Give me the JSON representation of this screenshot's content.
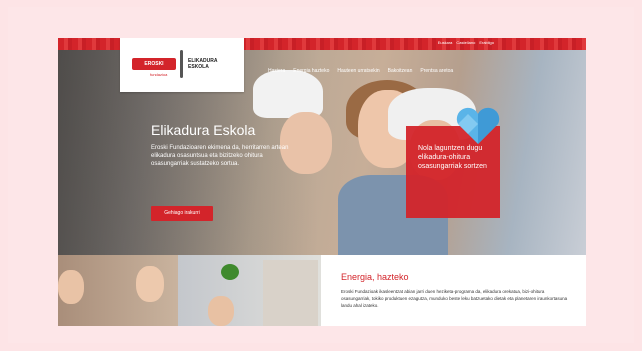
{
  "top_links": [
    "Euskara",
    "Castellano",
    "Erabilgo"
  ],
  "logo": {
    "brand": "EROSKI",
    "brand_sub": "fundazioa",
    "name_line1": "ELIKADURA",
    "name_line2": "ESKOLA"
  },
  "nav": [
    "Hasiera",
    "Energia hazteko",
    "Hauteen urratsekin",
    "Bakoitzean",
    "Prentsa aretoa"
  ],
  "hero": {
    "title": "Elikadura Eskola",
    "text": "Eroski Fundazioaren ekimena da, herritarren artean elikadura osasuntsua eta bizitzeko ohitura osasungarriak sustatzeko sortua.",
    "button": "Gehiago irakurri"
  },
  "callout": {
    "text": "Nola laguntzen dugu elikadura-ohitura osasungarriak sortzen"
  },
  "section": {
    "title": "Energia, hazteko",
    "text": "Eroski Fundazioak ikasleentzat abian jarri duen heziketa-programa da, elikadura orekatua, bizi-ohitura osasungarriak, tokiko produktuen ezagutza, munduko beste leku batzuetako dietak eta planetaren iraunkortasuna landu ahal izateko."
  },
  "colors": {
    "accent": "#d3242a",
    "background": "#fde4e6"
  }
}
